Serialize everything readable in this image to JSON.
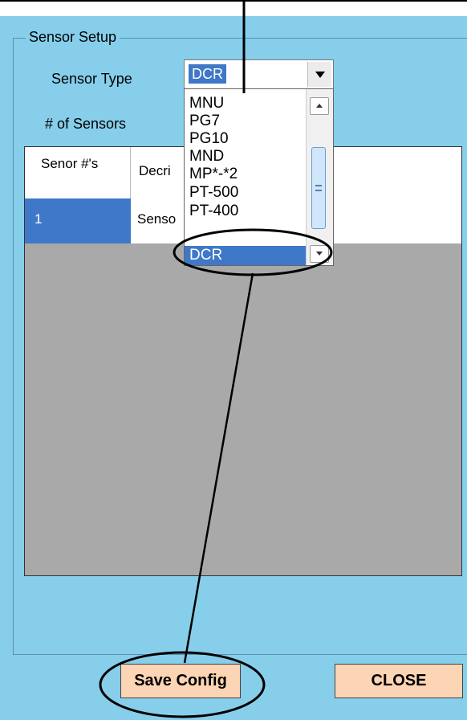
{
  "group_title": "Sensor Setup",
  "sensor_type": {
    "label": "Sensor Type",
    "selected_value": "DCR"
  },
  "num_sensors": {
    "label": "# of Sensors"
  },
  "dropdown": {
    "options": [
      "MNU",
      "PG7",
      "PG10",
      "MND",
      "MP*-*2",
      "PT-500",
      "PT-400",
      "DCR"
    ],
    "selected": "DCR"
  },
  "table": {
    "headers": [
      "Senor #'s",
      "Decri"
    ],
    "rows": [
      {
        "number": "1",
        "description": "Senso"
      }
    ]
  },
  "buttons": {
    "save": "Save Config",
    "close": "CLOSE"
  },
  "colors": {
    "panel_bg": "#87ceeb",
    "selection": "#3f78c8",
    "grid_bg": "#a9a9a9",
    "button_bg": "#fcd5b4"
  }
}
